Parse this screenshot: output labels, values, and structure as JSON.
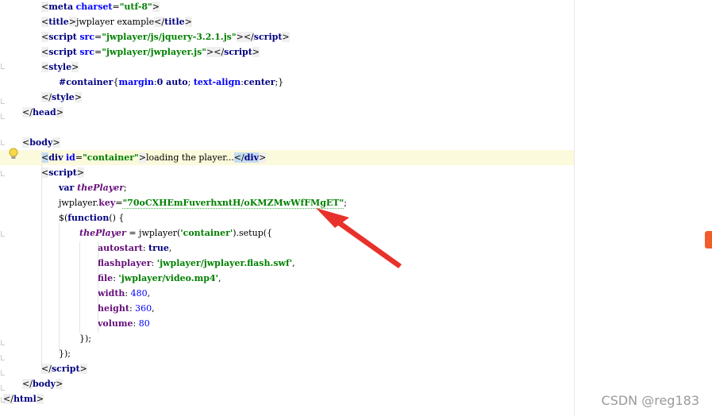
{
  "editor": {
    "lines": [
      {
        "parts": [
          {
            "t": "<",
            "c": "tag"
          },
          {
            "t": "meta",
            "c": "tagname"
          },
          {
            "t": " ",
            "c": ""
          },
          {
            "t": "charset",
            "c": "attr"
          },
          {
            "t": "=",
            "c": ""
          },
          {
            "t": "\"utf-8\"",
            "c": "str"
          },
          {
            "t": ">",
            "c": "tag"
          }
        ]
      },
      {
        "parts": [
          {
            "t": "<",
            "c": "tag"
          },
          {
            "t": "title",
            "c": "tagname"
          },
          {
            "t": ">",
            "c": "tag"
          },
          {
            "t": "jwplayer example",
            "c": ""
          },
          {
            "t": "</",
            "c": "tag"
          },
          {
            "t": "title",
            "c": "tagname"
          },
          {
            "t": ">",
            "c": "tag"
          }
        ]
      },
      {
        "parts": [
          {
            "t": "<",
            "c": "tag"
          },
          {
            "t": "script",
            "c": "tagname"
          },
          {
            "t": " ",
            "c": ""
          },
          {
            "t": "src",
            "c": "attr"
          },
          {
            "t": "=",
            "c": ""
          },
          {
            "t": "\"jwplayer/js/jquery-3.2.1.js\"",
            "c": "str"
          },
          {
            "t": "></",
            "c": "tag"
          },
          {
            "t": "script",
            "c": "tagname"
          },
          {
            "t": ">",
            "c": "tag"
          }
        ]
      },
      {
        "parts": [
          {
            "t": "<",
            "c": "tag"
          },
          {
            "t": "script",
            "c": "tagname"
          },
          {
            "t": " ",
            "c": ""
          },
          {
            "t": "src",
            "c": "attr"
          },
          {
            "t": "=",
            "c": ""
          },
          {
            "t": "\"jwplayer/jwplayer.js\"",
            "c": "str"
          },
          {
            "t": "></",
            "c": "tag"
          },
          {
            "t": "script",
            "c": "tagname"
          },
          {
            "t": ">",
            "c": "tag"
          }
        ]
      },
      {
        "parts": [
          {
            "t": "<",
            "c": "tag"
          },
          {
            "t": "style",
            "c": "tagname"
          },
          {
            "t": ">",
            "c": "tag"
          }
        ]
      },
      {
        "parts": [
          {
            "t": "#container",
            "c": "kw"
          },
          {
            "t": "{",
            "c": ""
          },
          {
            "t": "margin",
            "c": "attr"
          },
          {
            "t": ":",
            "c": ""
          },
          {
            "t": "0 auto",
            "c": "kw"
          },
          {
            "t": "; ",
            "c": ""
          },
          {
            "t": "text-align",
            "c": "attr"
          },
          {
            "t": ":",
            "c": ""
          },
          {
            "t": "center",
            "c": "kw"
          },
          {
            "t": ";}",
            "c": ""
          }
        ]
      },
      {
        "parts": [
          {
            "t": "</",
            "c": "tag"
          },
          {
            "t": "style",
            "c": "tagname"
          },
          {
            "t": ">",
            "c": "tag"
          }
        ]
      },
      {
        "parts": [
          {
            "t": "</",
            "c": "tag"
          },
          {
            "t": "head",
            "c": "tagname"
          },
          {
            "t": ">",
            "c": "tag"
          }
        ]
      },
      {
        "parts": []
      },
      {
        "parts": [
          {
            "t": "<",
            "c": "tag"
          },
          {
            "t": "body",
            "c": "tagname"
          },
          {
            "t": ">",
            "c": "tag"
          }
        ]
      },
      {
        "parts": [
          {
            "t": "<",
            "c": "tag hl"
          },
          {
            "t": "div",
            "c": "tagname"
          },
          {
            "t": " ",
            "c": ""
          },
          {
            "t": "id",
            "c": "attr"
          },
          {
            "t": "=",
            "c": ""
          },
          {
            "t": "\"container\"",
            "c": "str"
          },
          {
            "t": ">",
            "c": "tag"
          },
          {
            "t": "loading the player...",
            "c": ""
          },
          {
            "t": "</",
            "c": "tag hl"
          },
          {
            "t": "div",
            "c": "tagname hl"
          },
          {
            "t": ">",
            "c": "tag"
          }
        ]
      },
      {
        "parts": [
          {
            "t": "<",
            "c": "tag"
          },
          {
            "t": "script",
            "c": "tagname"
          },
          {
            "t": ">",
            "c": "tag"
          }
        ]
      },
      {
        "parts": [
          {
            "t": "var ",
            "c": "kw"
          },
          {
            "t": "thePlayer",
            "c": "pvar"
          },
          {
            "t": ";",
            "c": ""
          }
        ]
      },
      {
        "parts": [
          {
            "t": "jwplayer.",
            "c": ""
          },
          {
            "t": "key",
            "c": "prop"
          },
          {
            "t": "=",
            "c": ""
          },
          {
            "t": "\"70oCXHEmFuverhxntH/oKMZMwWfFMgET\"",
            "c": "str squiggle"
          },
          {
            "t": ";",
            "c": ""
          }
        ]
      },
      {
        "parts": [
          {
            "t": "$",
            "c": "fn"
          },
          {
            "t": "(",
            "c": ""
          },
          {
            "t": "function",
            "c": "kw"
          },
          {
            "t": "() {",
            "c": ""
          }
        ]
      },
      {
        "parts": [
          {
            "t": "thePlayer",
            "c": "pvar"
          },
          {
            "t": " = jwplayer(",
            "c": ""
          },
          {
            "t": "'container'",
            "c": "str"
          },
          {
            "t": ").",
            "c": ""
          },
          {
            "t": "setup",
            "c": "fn"
          },
          {
            "t": "({",
            "c": ""
          }
        ]
      },
      {
        "parts": [
          {
            "t": "autostart",
            "c": "prop"
          },
          {
            "t": ": ",
            "c": ""
          },
          {
            "t": "true",
            "c": "kw"
          },
          {
            "t": ",",
            "c": ""
          }
        ]
      },
      {
        "parts": [
          {
            "t": "flashplayer",
            "c": "prop"
          },
          {
            "t": ": ",
            "c": ""
          },
          {
            "t": "'jwplayer/jwplayer.flash.swf'",
            "c": "str"
          },
          {
            "t": ",",
            "c": ""
          }
        ]
      },
      {
        "parts": [
          {
            "t": "file",
            "c": "prop"
          },
          {
            "t": ": ",
            "c": ""
          },
          {
            "t": "'jwplayer/video.mp4'",
            "c": "str"
          },
          {
            "t": ",",
            "c": ""
          }
        ]
      },
      {
        "parts": [
          {
            "t": "width",
            "c": "prop"
          },
          {
            "t": ": ",
            "c": ""
          },
          {
            "t": "480",
            "c": "num"
          },
          {
            "t": ",",
            "c": ""
          }
        ]
      },
      {
        "parts": [
          {
            "t": "height",
            "c": "prop"
          },
          {
            "t": ": ",
            "c": ""
          },
          {
            "t": "360",
            "c": "num"
          },
          {
            "t": ",",
            "c": ""
          }
        ]
      },
      {
        "parts": [
          {
            "t": "volume",
            "c": "prop"
          },
          {
            "t": ": ",
            "c": ""
          },
          {
            "t": "80",
            "c": "num"
          }
        ]
      },
      {
        "parts": [
          {
            "t": "});",
            "c": ""
          }
        ]
      },
      {
        "parts": [
          {
            "t": "});",
            "c": ""
          }
        ]
      },
      {
        "parts": [
          {
            "t": "</",
            "c": "tag"
          },
          {
            "t": "script",
            "c": "tagname"
          },
          {
            "t": ">",
            "c": "tag"
          }
        ]
      },
      {
        "parts": [
          {
            "t": "</",
            "c": "tag"
          },
          {
            "t": "body",
            "c": "tagname"
          },
          {
            "t": ">",
            "c": "tag"
          }
        ]
      },
      {
        "parts": [
          {
            "t": "</",
            "c": "tag"
          },
          {
            "t": "html",
            "c": "tagname"
          },
          {
            "t": ">",
            "c": "tag"
          }
        ]
      }
    ]
  },
  "watermark": "CSDN @reg183",
  "colors": {
    "arrow": "#e8312a",
    "current_line": "#fbfadc"
  }
}
